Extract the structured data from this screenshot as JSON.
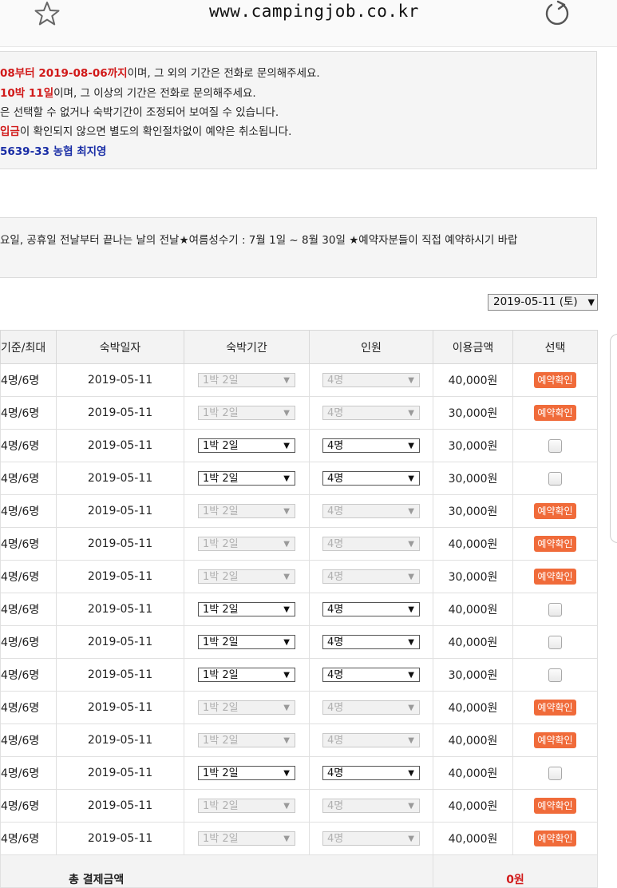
{
  "browser": {
    "url": "www.campingjob.co.kr",
    "bookmark_icon": "star-icon",
    "reload_icon": "reload-icon"
  },
  "notice": {
    "line1": {
      "highlight": "08부터 2019-08-06까지",
      "rest": "이며, 그 외의 기간은 전화로 문의해주세요."
    },
    "line2": {
      "highlight": "10박 11일",
      "rest": "이며, 그 이상의 기간은 전화로 문의해주세요."
    },
    "line3": {
      "text": "은 선택할 수 없거나 숙박기간이 조정되어 보여질 수 있습니다."
    },
    "line4": {
      "highlight": "입금",
      "rest": "이 확인되지 않으면 별도의 확인절차없이 예약은 취소됩니다."
    },
    "line5": {
      "highlight": "5639-33 농협 최지영"
    }
  },
  "info": {
    "text": "요일, 공휴일 전날부터 끝나는 날의 전날★여름성수기 : 7월 1일 ~ 8월 30일 ★예약자분들이 직접 예약하시기 바랍"
  },
  "date_select": {
    "value": "2019-05-11 (토)"
  },
  "table": {
    "headers": {
      "capacity": "기준/최대",
      "date": "숙박일자",
      "period": "숙박기간",
      "people": "인원",
      "price": "이용금액",
      "select": "선택"
    },
    "badge_label": "예약확인",
    "rows": [
      {
        "capacity": "4명/6명",
        "date": "2019-05-11",
        "period": "1박 2일",
        "people": "4명",
        "price": "40,000원",
        "reserved": true
      },
      {
        "capacity": "4명/6명",
        "date": "2019-05-11",
        "period": "1박 2일",
        "people": "4명",
        "price": "30,000원",
        "reserved": true
      },
      {
        "capacity": "4명/6명",
        "date": "2019-05-11",
        "period": "1박 2일",
        "people": "4명",
        "price": "30,000원",
        "reserved": false
      },
      {
        "capacity": "4명/6명",
        "date": "2019-05-11",
        "period": "1박 2일",
        "people": "4명",
        "price": "30,000원",
        "reserved": false
      },
      {
        "capacity": "4명/6명",
        "date": "2019-05-11",
        "period": "1박 2일",
        "people": "4명",
        "price": "30,000원",
        "reserved": true
      },
      {
        "capacity": "4명/6명",
        "date": "2019-05-11",
        "period": "1박 2일",
        "people": "4명",
        "price": "40,000원",
        "reserved": true
      },
      {
        "capacity": "4명/6명",
        "date": "2019-05-11",
        "period": "1박 2일",
        "people": "4명",
        "price": "30,000원",
        "reserved": true
      },
      {
        "capacity": "4명/6명",
        "date": "2019-05-11",
        "period": "1박 2일",
        "people": "4명",
        "price": "40,000원",
        "reserved": false
      },
      {
        "capacity": "4명/6명",
        "date": "2019-05-11",
        "period": "1박 2일",
        "people": "4명",
        "price": "40,000원",
        "reserved": false
      },
      {
        "capacity": "4명/6명",
        "date": "2019-05-11",
        "period": "1박 2일",
        "people": "4명",
        "price": "30,000원",
        "reserved": false
      },
      {
        "capacity": "4명/6명",
        "date": "2019-05-11",
        "period": "1박 2일",
        "people": "4명",
        "price": "40,000원",
        "reserved": true
      },
      {
        "capacity": "4명/6명",
        "date": "2019-05-11",
        "period": "1박 2일",
        "people": "4명",
        "price": "40,000원",
        "reserved": true
      },
      {
        "capacity": "4명/6명",
        "date": "2019-05-11",
        "period": "1박 2일",
        "people": "4명",
        "price": "40,000원",
        "reserved": false
      },
      {
        "capacity": "4명/6명",
        "date": "2019-05-11",
        "period": "1박 2일",
        "people": "4명",
        "price": "40,000원",
        "reserved": true
      },
      {
        "capacity": "4명/6명",
        "date": "2019-05-11",
        "period": "1박 2일",
        "people": "4명",
        "price": "40,000원",
        "reserved": true
      }
    ],
    "total": {
      "label": "총 결제금액",
      "value": "0원"
    }
  },
  "colors": {
    "accent_red": "#d11a1a",
    "bank_blue": "#1a2ea6",
    "badge_orange": "#f06b3a"
  }
}
